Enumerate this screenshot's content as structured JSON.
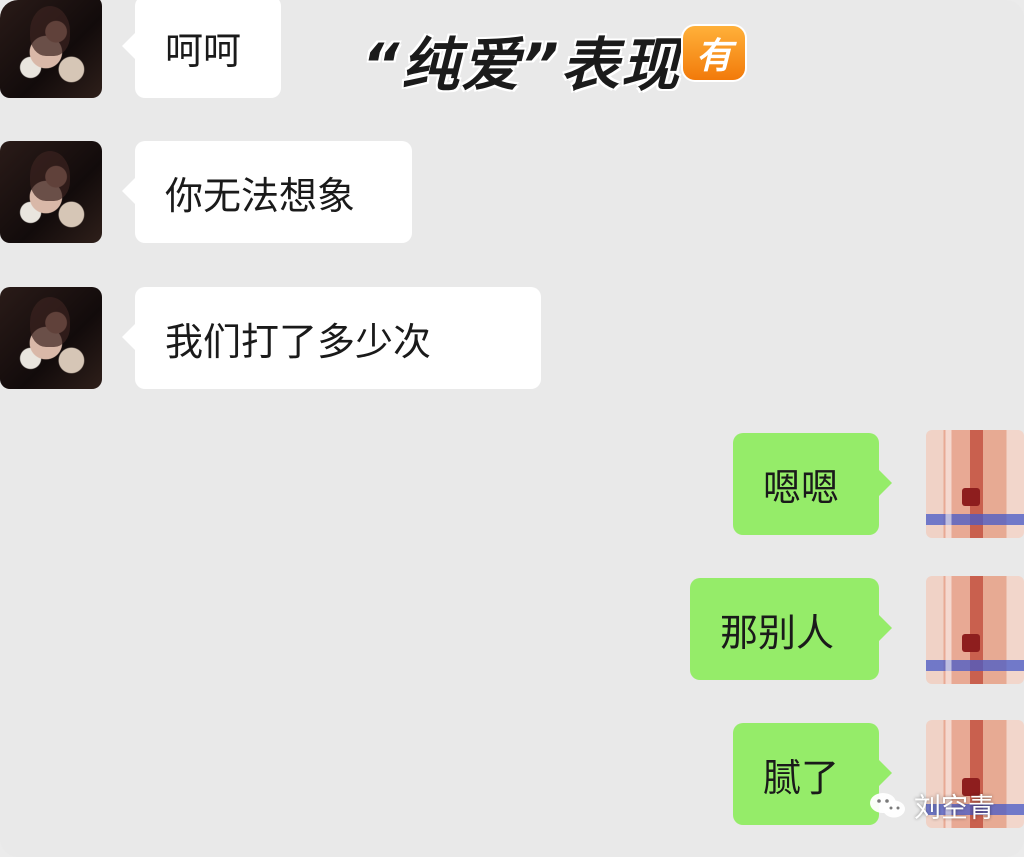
{
  "header": {
    "title": "“纯爱”表现",
    "badge": "有"
  },
  "messages": [
    {
      "side": "left",
      "text": "呵呵"
    },
    {
      "side": "left",
      "text": "你无法想象"
    },
    {
      "side": "left",
      "text": "我们打了多少次"
    },
    {
      "side": "right",
      "text": "嗯嗯"
    },
    {
      "side": "right",
      "text": "那别人"
    },
    {
      "side": "right",
      "text": "腻了"
    }
  ],
  "watermark": {
    "text": "刘空青",
    "icon": "wechat-icon"
  },
  "colors": {
    "background": "#e9e9e9",
    "left_bubble": "#ffffff",
    "right_bubble": "#95ec69",
    "badge": "#f28a14"
  }
}
